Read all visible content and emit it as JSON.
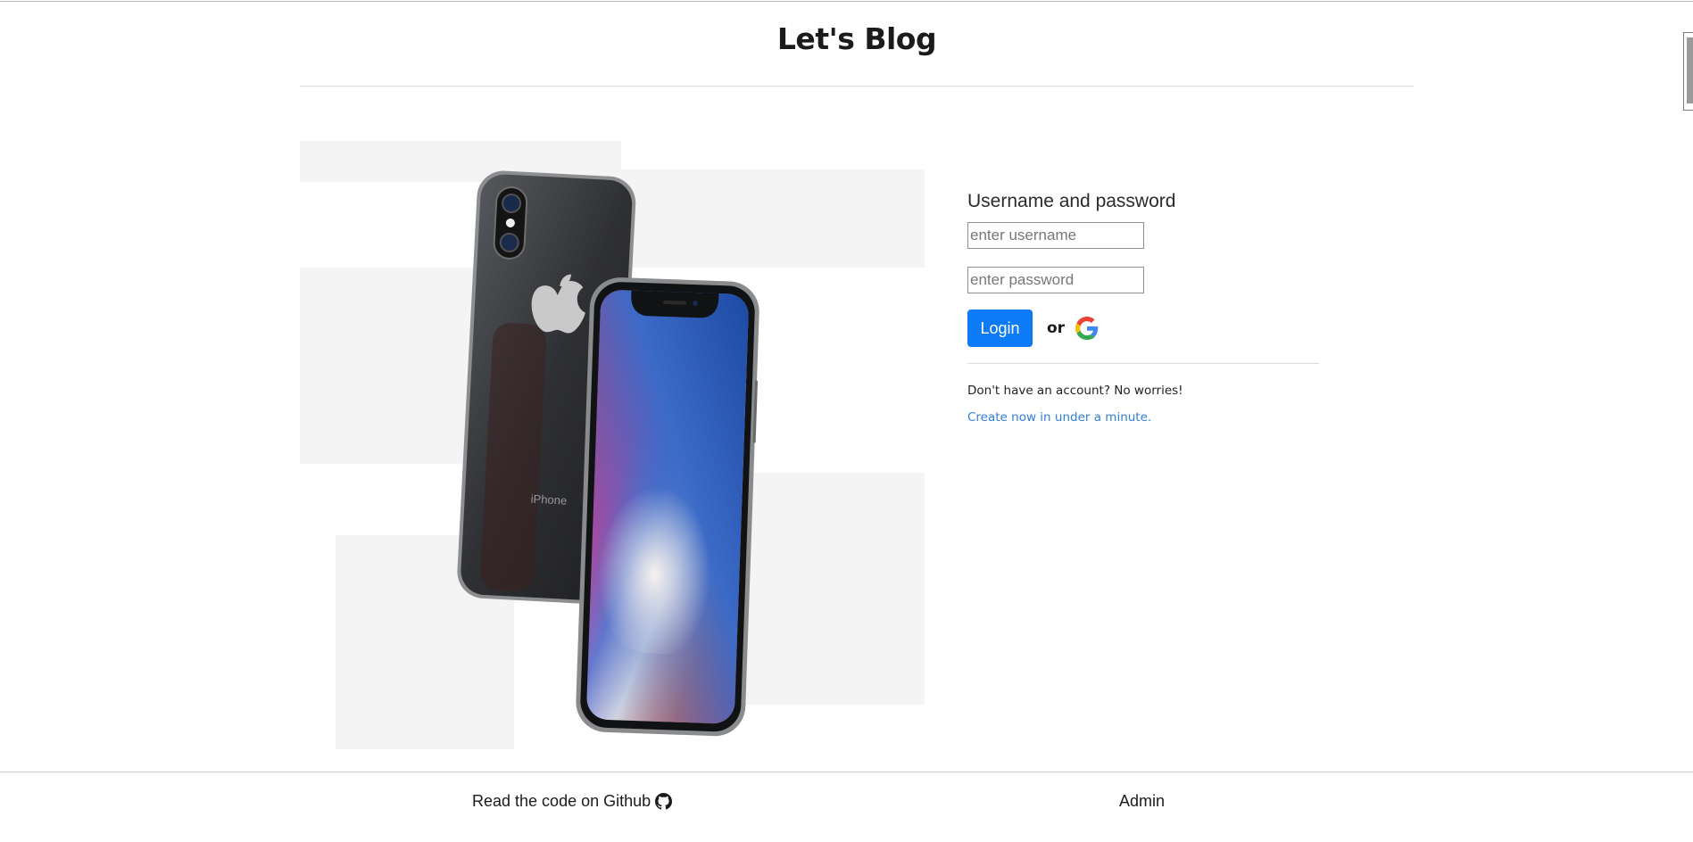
{
  "header": {
    "brand": "Let's Blog"
  },
  "hero": {
    "brand_mark": "iPhone"
  },
  "login": {
    "heading": "Username and password",
    "username_placeholder": "enter username",
    "password_placeholder": "enter password",
    "login_label": "Login",
    "or_label": "or",
    "google_icon": "google-icon",
    "note": "Don't have an account? No worries!",
    "signup_link": "Create now in under a minute."
  },
  "footer": {
    "github_link": "Read the code on Github",
    "github_icon": "github-icon",
    "admin_link": "Admin"
  },
  "colors": {
    "primary": "#0d7bf5",
    "link": "#2f7fd6"
  }
}
